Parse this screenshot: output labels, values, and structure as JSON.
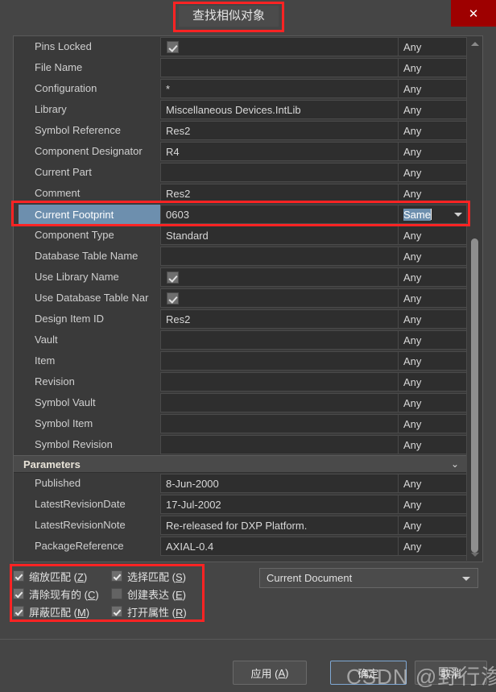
{
  "window": {
    "title": "查找相似对象",
    "close_icon": "close-icon",
    "close_label": "✕"
  },
  "list": {
    "rows": [
      {
        "label": "Pins Locked",
        "value": "",
        "checkbox": true,
        "any": "Any"
      },
      {
        "label": "File Name",
        "value": "",
        "checkbox": false,
        "any": "Any"
      },
      {
        "label": "Configuration",
        "value": "*",
        "checkbox": false,
        "any": "Any"
      },
      {
        "label": "Library",
        "value": "Miscellaneous Devices.IntLib",
        "checkbox": false,
        "any": "Any"
      },
      {
        "label": "Symbol Reference",
        "value": "Res2",
        "checkbox": false,
        "any": "Any"
      },
      {
        "label": "Component Designator",
        "value": "R4",
        "checkbox": false,
        "any": "Any"
      },
      {
        "label": "Current Part",
        "value": "",
        "checkbox": false,
        "any": "Any"
      },
      {
        "label": "Comment",
        "value": "Res2",
        "checkbox": false,
        "any": "Any"
      },
      {
        "label": "Current Footprint",
        "value": "0603",
        "checkbox": false,
        "any": "Same",
        "selected": true
      },
      {
        "label": "Component Type",
        "value": "Standard",
        "checkbox": false,
        "any": "Any"
      },
      {
        "label": "Database Table Name",
        "value": "",
        "checkbox": false,
        "any": "Any"
      },
      {
        "label": "Use Library Name",
        "value": "",
        "checkbox": true,
        "any": "Any"
      },
      {
        "label": "Use Database Table Nar",
        "value": "",
        "checkbox": true,
        "any": "Any"
      },
      {
        "label": "Design Item ID",
        "value": "Res2",
        "checkbox": false,
        "any": "Any"
      },
      {
        "label": "Vault",
        "value": "",
        "checkbox": false,
        "any": "Any"
      },
      {
        "label": "Item",
        "value": "",
        "checkbox": false,
        "any": "Any"
      },
      {
        "label": "Revision",
        "value": "",
        "checkbox": false,
        "any": "Any"
      },
      {
        "label": "Symbol Vault",
        "value": "",
        "checkbox": false,
        "any": "Any"
      },
      {
        "label": "Symbol Item",
        "value": "",
        "checkbox": false,
        "any": "Any"
      },
      {
        "label": "Symbol Revision",
        "value": "",
        "checkbox": false,
        "any": "Any"
      }
    ],
    "group": {
      "title": "Parameters",
      "chevron": "chevron-double-down-icon",
      "chevron_glyph": "⌄"
    },
    "parameter_rows": [
      {
        "label": "Published",
        "value": "8-Jun-2000",
        "checkbox": false,
        "any": "Any"
      },
      {
        "label": "LatestRevisionDate",
        "value": "17-Jul-2002",
        "checkbox": false,
        "any": "Any"
      },
      {
        "label": "LatestRevisionNote",
        "value": "Re-released for DXP Platform.",
        "checkbox": false,
        "any": "Any"
      },
      {
        "label": "PackageReference",
        "value": "AXIAL-0.4",
        "checkbox": false,
        "any": "Any"
      }
    ]
  },
  "options": [
    {
      "label": "缩放匹配 (Z)",
      "accel": "Z",
      "checked": true,
      "name": "zoom-matching"
    },
    {
      "label": "选择匹配 (S)",
      "accel": "S",
      "checked": true,
      "name": "select-matching"
    },
    {
      "label": "清除现有的 (C)",
      "accel": "C",
      "checked": true,
      "name": "clear-existing"
    },
    {
      "label": "创建表达 (E)",
      "accel": "E",
      "checked": false,
      "name": "create-expression"
    },
    {
      "label": "屏蔽匹配 (M)",
      "accel": "M",
      "checked": true,
      "name": "mask-matching"
    },
    {
      "label": "打开属性 (R)",
      "accel": "R",
      "checked": true,
      "name": "run-inspector"
    }
  ],
  "scope": {
    "selected": "Current Document",
    "arrow_icon": "chevron-down-icon"
  },
  "footer": {
    "apply": "应用 (A)",
    "ok": "确定",
    "cancel": "取消"
  },
  "watermark": "CSDN @野行渗风",
  "colors": {
    "accent_red": "#ff2323",
    "selection_blue": "#6d8fae",
    "close_red": "#9e0000",
    "panel_bg": "#3a3a3a",
    "window_bg": "#454545"
  }
}
